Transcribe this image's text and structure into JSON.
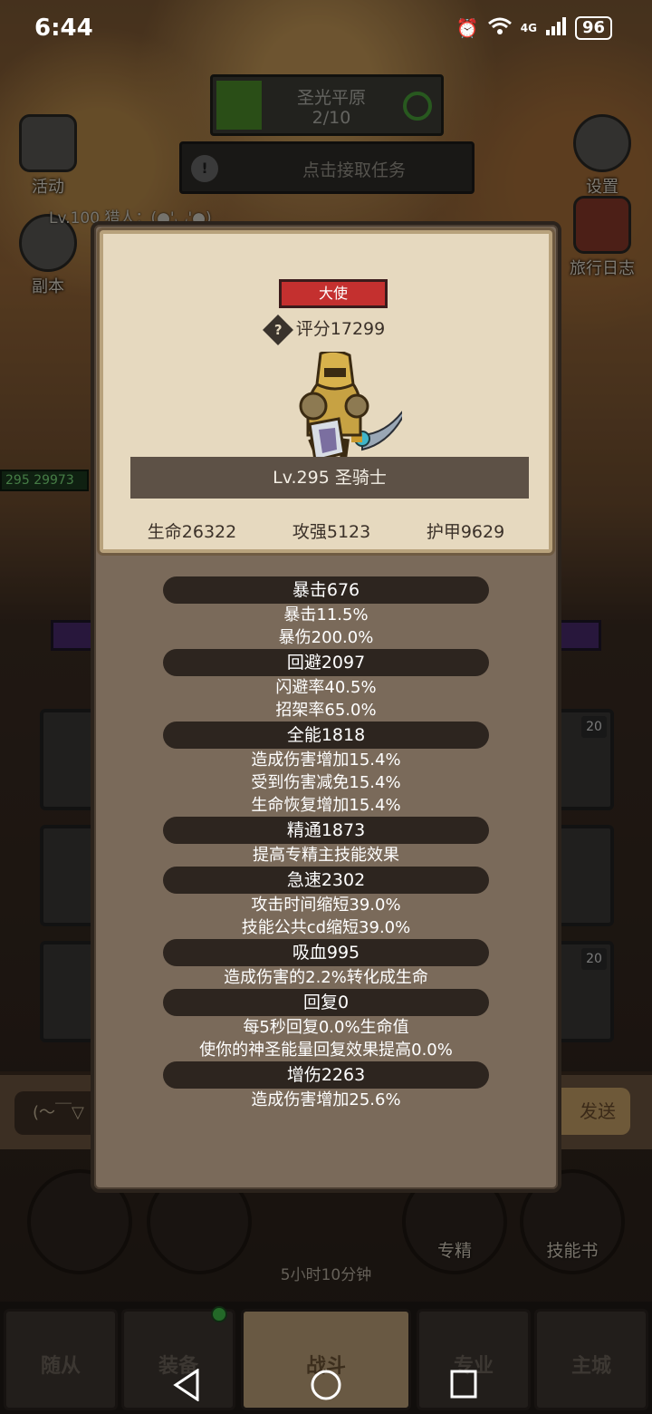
{
  "status_bar": {
    "time": "6:44",
    "network": "4G",
    "battery": "96"
  },
  "background": {
    "map": {
      "name": "圣光平原",
      "progress": "2/10"
    },
    "task": {
      "label": "点击接取任务"
    },
    "left_buttons": [
      {
        "label": "活动",
        "icon": "scroll-icon"
      },
      {
        "label": "副本",
        "icon": "portal-icon"
      }
    ],
    "right_buttons": [
      {
        "label": "设置",
        "icon": "gear-icon"
      },
      {
        "label": "旅行日志",
        "icon": "journal-icon"
      }
    ],
    "player_level_text": "Lv.100 猎人：(●'◡'●)",
    "hp_strip": {
      "level": "295",
      "value": "29973"
    },
    "item_badges": [
      "20",
      "20"
    ],
    "chat": {
      "input": "(～￣▽",
      "send": "发送"
    },
    "round_buttons": [
      {
        "label": "",
        "icon": "potion-icon"
      },
      {
        "label": "",
        "icon": "bread-icon"
      },
      {
        "label": "专精",
        "icon": "spec-icon"
      },
      {
        "label": "技能书",
        "icon": "skillbook-icon"
      }
    ],
    "chest_timer": "5小时10分钟",
    "nav_tabs": [
      {
        "label": "随从",
        "active": false
      },
      {
        "label": "装备",
        "active": false,
        "dot": true
      },
      {
        "label": "战斗",
        "active": true
      },
      {
        "label": "专业",
        "active": false
      },
      {
        "label": "主城",
        "active": false
      }
    ]
  },
  "panel": {
    "rank_tag": "大使",
    "score": "评分17299",
    "name_plate": "Lv.295 圣骑士",
    "base_stats": {
      "hp": "生命26322",
      "atk": "攻强5123",
      "armor": "护甲9629"
    },
    "stat_groups": [
      {
        "title": "暴击676",
        "lines": [
          "暴击11.5%",
          "暴伤200.0%"
        ]
      },
      {
        "title": "回避2097",
        "lines": [
          "闪避率40.5%",
          "招架率65.0%"
        ]
      },
      {
        "title": "全能1818",
        "lines": [
          "造成伤害增加15.4%",
          "受到伤害减免15.4%",
          "生命恢复增加15.4%"
        ]
      },
      {
        "title": "精通1873",
        "lines": [
          "提高专精主技能效果"
        ]
      },
      {
        "title": "急速2302",
        "lines": [
          "攻击时间缩短39.0%",
          "技能公共cd缩短39.0%"
        ]
      },
      {
        "title": "吸血995",
        "lines": [
          "造成伤害的2.2%转化成生命"
        ]
      },
      {
        "title": "回复0",
        "lines": [
          "每5秒回复0.0%生命值",
          "使你的神圣能量回复效果提高0.0%"
        ]
      },
      {
        "title": "增伤2263",
        "lines": [
          "造成伤害增加25.6%"
        ]
      }
    ]
  },
  "system_nav": {
    "back": "◁",
    "home": "○",
    "recents": "□"
  }
}
